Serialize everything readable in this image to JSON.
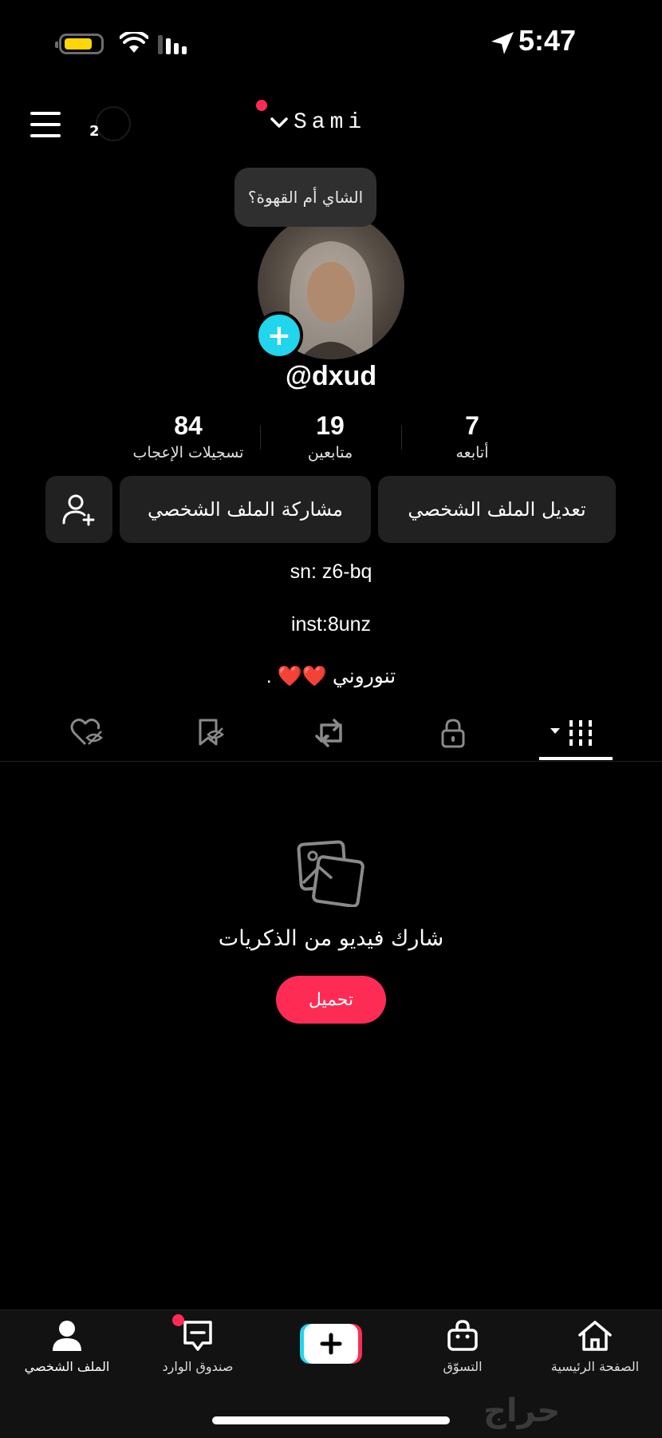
{
  "status_bar": {
    "time": "5:47",
    "icons": [
      "battery-icon",
      "wifi-icon",
      "signal-icon",
      "location-arrow-icon"
    ]
  },
  "header": {
    "notification_count": "2",
    "account_name": "Sami"
  },
  "profile": {
    "note_bubble": "الشاي أم القهوة؟",
    "username": "@dxud",
    "stats": [
      {
        "value": "84",
        "label": "تسجيلات الإعجاب"
      },
      {
        "value": "19",
        "label": "متابعين"
      },
      {
        "value": "7",
        "label": "أتابعه"
      }
    ],
    "buttons": {
      "edit": "تعديل الملف الشخصي",
      "share": "مشاركة الملف الشخصي"
    },
    "bio_lines": [
      "sn: z6-bq",
      "inst:8unz",
      "تنوروني ❤️❤️ ."
    ]
  },
  "tabs": [
    "videos-grid-icon",
    "lock-icon",
    "repost-icon",
    "favorites-icon",
    "liked-icon"
  ],
  "empty_state": {
    "text": "شارك فيديو من الذكريات",
    "button": "تحميل"
  },
  "bottom_nav": {
    "home": "الصفحة الرئيسية",
    "shop": "التسوّق",
    "inbox": "صندوق الوارد",
    "profile": "الملف الشخصي"
  },
  "watermark": "حراج",
  "colors": {
    "accent": "#fe2c55",
    "cyan": "#20d5ec",
    "background": "#000000"
  }
}
